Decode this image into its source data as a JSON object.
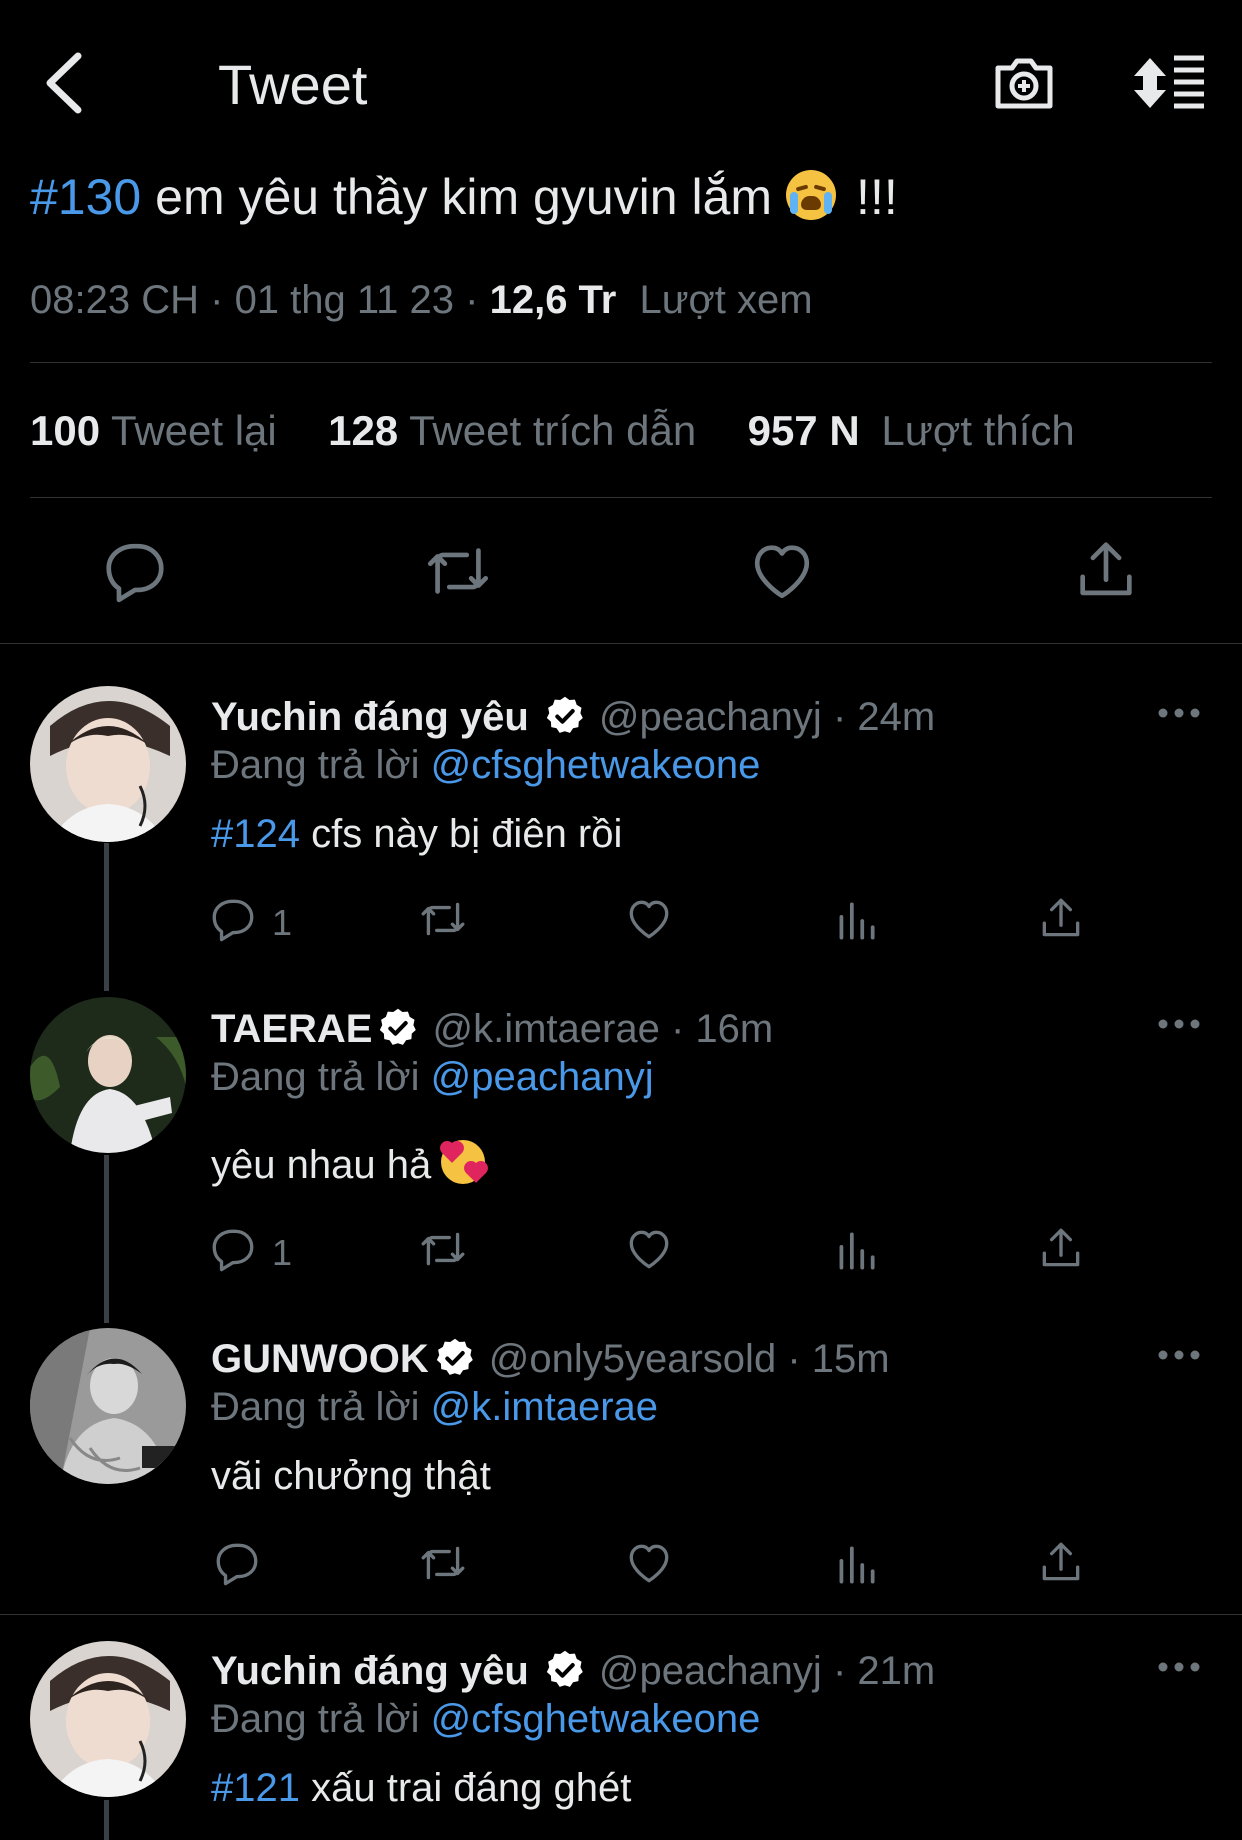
{
  "header": {
    "title": "Tweet"
  },
  "main_tweet": {
    "hashtag": "#130",
    "text": "em yêu thầy kim gyuvin lắm",
    "emoji": "loudly-crying-face-emoji",
    "exclaim": "!!!",
    "time": "08:23 CH",
    "sep": "·",
    "date": "01 thg 11 23",
    "views_count": "12,6 Tr",
    "views_label": "Lượt xem",
    "stats": {
      "retweets_count": "100",
      "retweets_label": "Tweet lại",
      "quotes_count": "128",
      "quotes_label": "Tweet trích dẫn",
      "likes_count": "957 N",
      "likes_label": "Lượt thích"
    }
  },
  "replies": [
    {
      "name": "Yuchin đáng yêu",
      "handle": "@peachanyj",
      "time": "· 24m",
      "replying_label": "Đang trả lời",
      "replying_to": "@cfsghetwakeone",
      "hashtag": "#124",
      "text": "cfs này bị điên rồi",
      "reply_count": "1"
    },
    {
      "name": "TAERAE",
      "handle": "@k.imtaerae",
      "time": "· 16m",
      "replying_label": "Đang trả lời",
      "replying_to": "@peachanyj",
      "hashtag": "",
      "text": "yêu nhau hả",
      "reply_count": "1"
    },
    {
      "name": "GUNWOOK",
      "handle": "@only5yearsold",
      "time": "· 15m",
      "replying_label": "Đang trả lời",
      "replying_to": "@k.imtaerae",
      "hashtag": "",
      "text": "vãi chưởng thật",
      "reply_count": ""
    },
    {
      "name": "Yuchin đáng yêu",
      "handle": "@peachanyj",
      "time": "· 21m",
      "replying_label": "Đang trả lời",
      "replying_to": "@cfsghetwakeone",
      "hashtag": "#121",
      "text": "xấu trai đáng ghét",
      "reply_count": ""
    }
  ],
  "colors": {
    "background": "#000000",
    "link": "#4a99e9",
    "muted": "#6e767d",
    "text": "#e7e9ea",
    "divider": "#2f3336",
    "verified": "#ffffff"
  }
}
